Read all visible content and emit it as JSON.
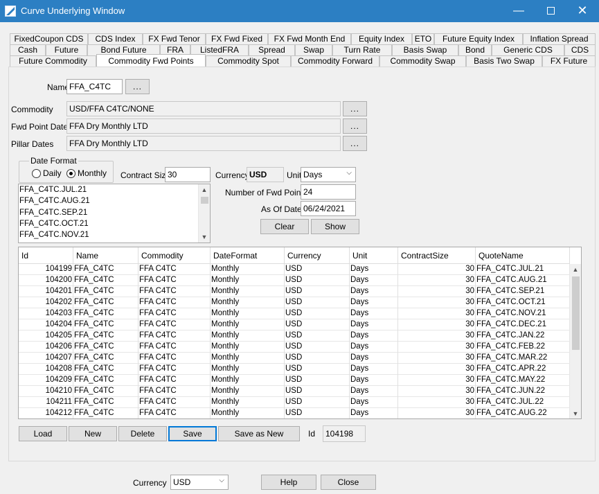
{
  "window": {
    "title": "Curve Underlying Window",
    "minimize": "—",
    "close": "✕"
  },
  "tabs": {
    "row1": [
      "FixedCoupon CDS",
      "CDS Index",
      "FX Fwd Tenor",
      "FX Fwd Fixed",
      "FX Fwd Month End",
      "Equity Index",
      "ETO",
      "Future Equity Index",
      "Inflation Spread"
    ],
    "row2": [
      "Cash",
      "Future",
      "Bond Future",
      "FRA",
      "ListedFRA",
      "Spread",
      "Swap",
      "Turn Rate",
      "Basis Swap",
      "Bond",
      "Generic CDS",
      "CDS"
    ],
    "row3": [
      "Future Commodity",
      "Commodity Fwd Points",
      "Commodity Spot",
      "Commodity Forward",
      "Commodity Swap",
      "Basis Two Swap",
      "FX Future"
    ],
    "active": "Commodity Fwd Points"
  },
  "form": {
    "name_label": "Name",
    "name_value": "FFA_C4TC",
    "ellipsis": "...",
    "commodity_label": "Commodity",
    "commodity_value": "USD/FFA C4TC/NONE",
    "fwd_point_dates_label": "Fwd Point Dates",
    "fwd_point_dates_value": "FFA Dry Monthly LTD",
    "pillar_dates_label": "Pillar Dates",
    "pillar_dates_value": "FFA Dry Monthly LTD",
    "date_format_title": "Date Format",
    "daily_label": "Daily",
    "monthly_label": "Monthly",
    "selected_date_format": "Monthly",
    "contract_size_label": "Contract Size",
    "contract_size_value": "30",
    "currency_label": "Currency",
    "currency_value": "USD",
    "unit_label": "Unit",
    "unit_value": "Days",
    "num_fwd_points_label": "Number of Fwd Points",
    "num_fwd_points_value": "24",
    "as_of_date_label": "As Of Date",
    "as_of_date_value": "06/24/2021",
    "clear_button": "Clear",
    "show_button": "Show"
  },
  "quote_list": [
    "FFA_C4TC.JUL.21",
    "FFA_C4TC.AUG.21",
    "FFA_C4TC.SEP.21",
    "FFA_C4TC.OCT.21",
    "FFA_C4TC.NOV.21"
  ],
  "table": {
    "columns": [
      "Id",
      "Name",
      "Commodity",
      "DateFormat",
      "Currency",
      "Unit",
      "ContractSize",
      "QuoteName"
    ],
    "rows": [
      [
        "104199",
        "FFA_C4TC",
        "FFA C4TC",
        "Monthly",
        "USD",
        "Days",
        "30",
        "FFA_C4TC.JUL.21"
      ],
      [
        "104200",
        "FFA_C4TC",
        "FFA C4TC",
        "Monthly",
        "USD",
        "Days",
        "30",
        "FFA_C4TC.AUG.21"
      ],
      [
        "104201",
        "FFA_C4TC",
        "FFA C4TC",
        "Monthly",
        "USD",
        "Days",
        "30",
        "FFA_C4TC.SEP.21"
      ],
      [
        "104202",
        "FFA_C4TC",
        "FFA C4TC",
        "Monthly",
        "USD",
        "Days",
        "30",
        "FFA_C4TC.OCT.21"
      ],
      [
        "104203",
        "FFA_C4TC",
        "FFA C4TC",
        "Monthly",
        "USD",
        "Days",
        "30",
        "FFA_C4TC.NOV.21"
      ],
      [
        "104204",
        "FFA_C4TC",
        "FFA C4TC",
        "Monthly",
        "USD",
        "Days",
        "30",
        "FFA_C4TC.DEC.21"
      ],
      [
        "104205",
        "FFA_C4TC",
        "FFA C4TC",
        "Monthly",
        "USD",
        "Days",
        "30",
        "FFA_C4TC.JAN.22"
      ],
      [
        "104206",
        "FFA_C4TC",
        "FFA C4TC",
        "Monthly",
        "USD",
        "Days",
        "30",
        "FFA_C4TC.FEB.22"
      ],
      [
        "104207",
        "FFA_C4TC",
        "FFA C4TC",
        "Monthly",
        "USD",
        "Days",
        "30",
        "FFA_C4TC.MAR.22"
      ],
      [
        "104208",
        "FFA_C4TC",
        "FFA C4TC",
        "Monthly",
        "USD",
        "Days",
        "30",
        "FFA_C4TC.APR.22"
      ],
      [
        "104209",
        "FFA_C4TC",
        "FFA C4TC",
        "Monthly",
        "USD",
        "Days",
        "30",
        "FFA_C4TC.MAY.22"
      ],
      [
        "104210",
        "FFA_C4TC",
        "FFA C4TC",
        "Monthly",
        "USD",
        "Days",
        "30",
        "FFA_C4TC.JUN.22"
      ],
      [
        "104211",
        "FFA_C4TC",
        "FFA C4TC",
        "Monthly",
        "USD",
        "Days",
        "30",
        "FFA_C4TC.JUL.22"
      ],
      [
        "104212",
        "FFA_C4TC",
        "FFA C4TC",
        "Monthly",
        "USD",
        "Days",
        "30",
        "FFA_C4TC.AUG.22"
      ]
    ]
  },
  "actions": {
    "load": "Load",
    "new": "New",
    "delete": "Delete",
    "save": "Save",
    "save_as_new": "Save as New",
    "id_label": "Id",
    "id_value": "104198"
  },
  "footer": {
    "currency_label": "Currency",
    "currency_value": "USD",
    "help": "Help",
    "close": "Close"
  },
  "colors": {
    "titlebar": "#2c7fc3",
    "focus": "#0078d7"
  }
}
